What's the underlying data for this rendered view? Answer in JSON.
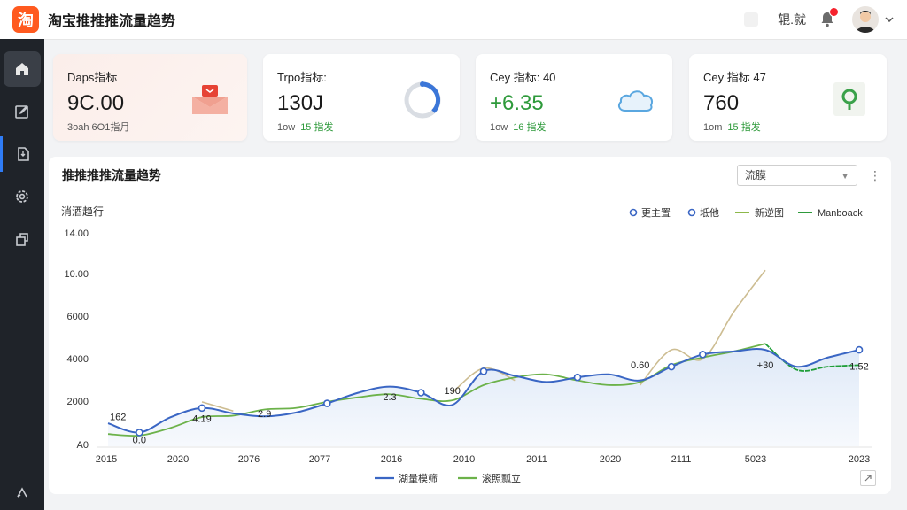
{
  "header": {
    "logo_text": "淘",
    "title": "淘宝推推推流量趋势",
    "user_name": "辊.就",
    "accent": "#ff5a1f"
  },
  "sidebar": {
    "items": [
      {
        "icon": "home-icon",
        "active": true
      },
      {
        "icon": "edit-icon",
        "active": false
      },
      {
        "icon": "document-icon",
        "active": false
      },
      {
        "icon": "settings-icon",
        "active": false
      },
      {
        "icon": "copy-icon",
        "active": false
      },
      {
        "icon": "share-icon",
        "active": false
      }
    ]
  },
  "cards": [
    {
      "label": "Daps指标",
      "value": "9C.00",
      "sub": "3oah  6O1指月",
      "sub_up": "",
      "icon": "gift-icon"
    },
    {
      "label": "Trpo指标:",
      "value": "130J",
      "sub": "1ow",
      "sub_up": "15 指发",
      "icon": "ring-progress-icon"
    },
    {
      "label": "Cey 指标: 40",
      "value": "+6.35",
      "sub": "1ow",
      "sub_up": "16 指发",
      "icon": "cloud-icon"
    },
    {
      "label": "Cey 指标 47",
      "value": "760",
      "sub": "1om",
      "sub_up": "15 指发",
      "icon": "pin-icon"
    }
  ],
  "panel": {
    "title": "推推推推流量趋势",
    "select_value": "流膜",
    "more_icon": "more-vertical-icon",
    "expand_icon": "expand-icon"
  },
  "chart_data": {
    "type": "line",
    "title": "",
    "ylabel": "消酒趋行",
    "y_ticks": [
      "A0",
      "2000",
      "4000",
      "6000",
      "10.00",
      "14.00"
    ],
    "x_ticks": [
      "2015",
      "2020",
      "2076",
      "2077",
      "2016",
      "2010",
      "2011",
      "2020",
      "2111",
      "5023",
      "2023"
    ],
    "top_legend": [
      {
        "label": "更主置",
        "color": "#3a66c4",
        "marker": "circle"
      },
      {
        "label": "坻他",
        "color": "#3a66c4",
        "marker": "circle"
      },
      {
        "label": "新逆图",
        "color": "#8db84a",
        "marker": "line"
      },
      {
        "label": "Manboack",
        "color": "#2e9a3b",
        "marker": "line"
      }
    ],
    "bottom_legend": [
      {
        "label": "湖量模筛",
        "color": "#3a66c4"
      },
      {
        "label": "滚照瓢立",
        "color": "#6cb24a"
      }
    ],
    "series": [
      {
        "name": "湖量模筛",
        "color": "#3a66c4",
        "values": [
          1.5,
          0.9,
          1.9,
          2.5,
          2.15,
          1.95,
          2.2,
          2.8,
          3.5,
          3.9,
          3.5,
          2.7,
          4.9,
          4.6,
          4.2,
          4.5,
          4.7,
          4.3,
          5.2,
          6.0,
          6.2,
          6.3,
          5.2,
          5.8,
          6.3
        ],
        "markers": [
          1,
          3,
          7,
          10,
          12,
          15,
          18,
          19,
          24
        ]
      },
      {
        "name": "滚照瓢立",
        "color": "#6cb24a",
        "values": [
          0.8,
          0.7,
          1.2,
          1.9,
          2.0,
          2.4,
          2.5,
          2.9,
          3.2,
          3.4,
          3.1,
          3.0,
          4.0,
          4.5,
          4.7,
          4.3,
          4.0,
          4.2,
          5.3,
          5.8,
          6.2,
          6.7,
          5.0,
          5.2,
          5.3
        ],
        "emphasis_from": 21
      },
      {
        "name": "新逆图",
        "color": "#cdbd92",
        "values": [
          null,
          null,
          null,
          2.9,
          2.3,
          null,
          null,
          null,
          null,
          null,
          null,
          3.5,
          5.1,
          4.3,
          null,
          null,
          null,
          4.0,
          6.3,
          5.7,
          8.8,
          11.5,
          null,
          null,
          null
        ]
      }
    ],
    "annotations": [
      {
        "text": "162",
        "index": 0,
        "value": 1.7
      },
      {
        "text": "0.0",
        "index": 1,
        "value": 0.2
      },
      {
        "text": "4.19",
        "index": 3,
        "value": 1.6
      },
      {
        "text": "2.9",
        "index": 5,
        "value": 1.9
      },
      {
        "text": "2.3",
        "index": 9,
        "value": 3.0
      },
      {
        "text": "190",
        "index": 11,
        "value": 3.4
      },
      {
        "text": "0.60",
        "index": 17,
        "value": 5.1
      },
      {
        "text": "+30",
        "index": 21,
        "value": 5.1
      },
      {
        "text": "1.52",
        "index": 24,
        "value": 5.0
      }
    ],
    "ylim": [
      0,
      14
    ],
    "grid": false,
    "area_fill": "#dde8f7"
  }
}
